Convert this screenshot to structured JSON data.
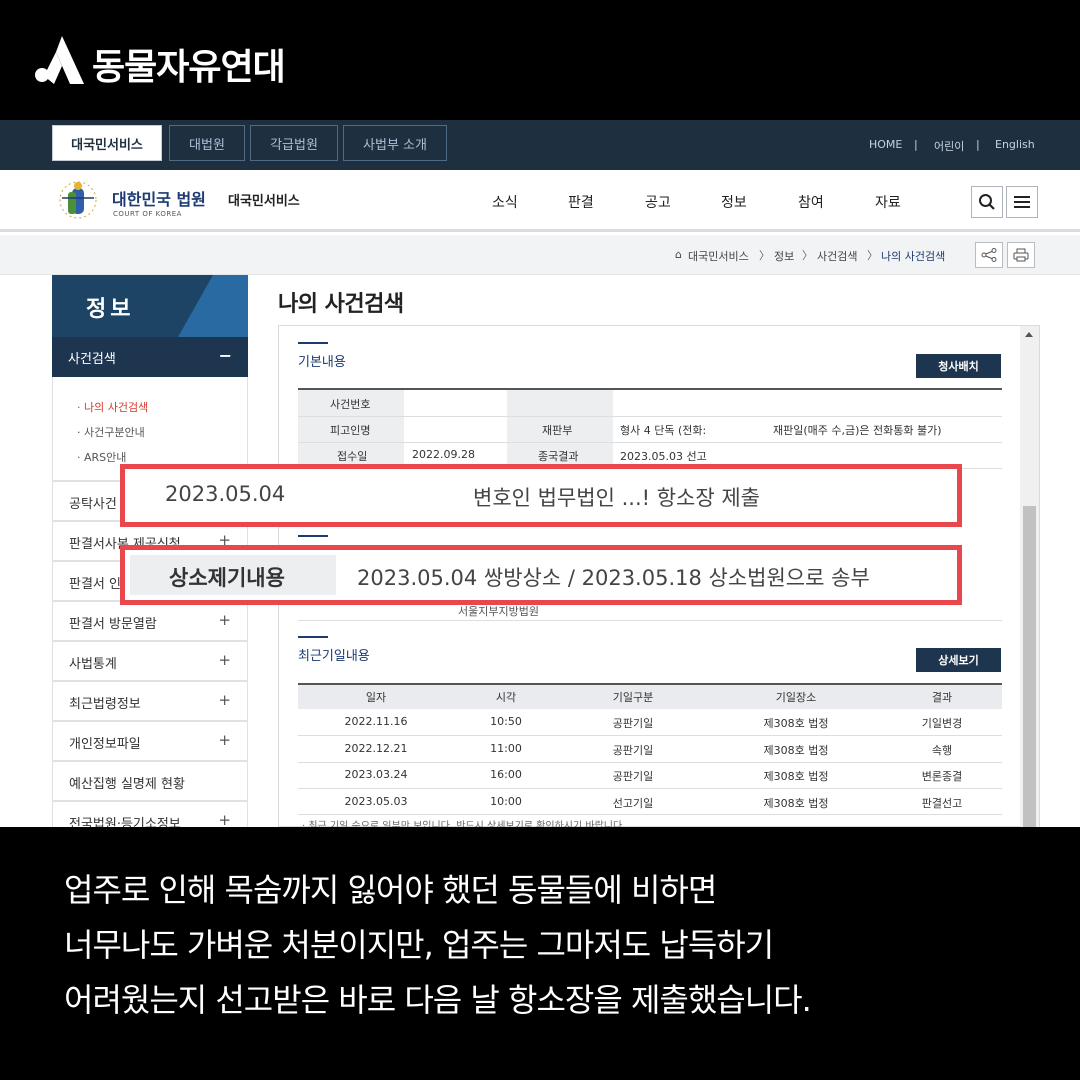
{
  "brand": {
    "name": "동물자유연대",
    "logo_icon": "triangle-person-logo"
  },
  "gnb": {
    "tabs": [
      "대국민서비스",
      "대법원",
      "각급법원",
      "사법부 소개"
    ],
    "utilities": [
      "HOME",
      "|",
      "어린이",
      "|",
      "English"
    ]
  },
  "header": {
    "court_name": "대한민국 법원",
    "court_name_en": "COURT OF KOREA",
    "service_name": "대국민서비스",
    "menu": [
      "소식",
      "판결",
      "공고",
      "정보",
      "참여",
      "자료"
    ]
  },
  "breadcrumb": {
    "home_icon": "home-icon",
    "items": [
      "대국민서비스",
      "정보",
      "사건검색",
      "나의 사건검색"
    ],
    "separator": "〉"
  },
  "sidebar": {
    "title": "정보",
    "active": {
      "label": "사건검색",
      "toggle": "−"
    },
    "subitems": [
      "· 나의 사건검색",
      "· 사건구분안내",
      "· ARS안내"
    ],
    "items": [
      {
        "label": "공탁사건",
        "toggle": "+"
      },
      {
        "label": "판결서사본 제공신청",
        "toggle": "+"
      },
      {
        "label": "판결서 인",
        "toggle": "+"
      },
      {
        "label": "판결서 방문열람",
        "toggle": "+"
      },
      {
        "label": "사법통계",
        "toggle": "+"
      },
      {
        "label": "최근법령정보",
        "toggle": "+"
      },
      {
        "label": "개인정보파일",
        "toggle": "+"
      },
      {
        "label": "예산집행 실명제 현황",
        "toggle": ""
      },
      {
        "label": "전국법원·등기소정보",
        "toggle": "+"
      }
    ]
  },
  "main": {
    "page_title": "나의 사건검색",
    "basic_section": {
      "title": "기본내용",
      "print_button": "청사배치",
      "labels": {
        "case_number": "사건번호",
        "defendant": "피고인명",
        "trial_division": "재판부",
        "received_date": "접수일",
        "final_result": "종국결과"
      },
      "values": {
        "trial_division": "형사 4 단독 (전화:",
        "trial_note": "재판일(매주 수,금)은 전화통화 불가)",
        "received_date": "2022.09.28",
        "final_result": "2023.05.03 선고"
      }
    },
    "partial_row_text": "서울지부지방법원",
    "recent_section": {
      "title": "최근기일내용",
      "detail_button": "상세보기",
      "columns": [
        "일자",
        "시각",
        "기일구분",
        "기일장소",
        "결과"
      ],
      "rows": [
        [
          "2022.11.16",
          "10:50",
          "공판기일",
          "제308호 법정",
          "기일변경"
        ],
        [
          "2022.12.21",
          "11:00",
          "공판기일",
          "제308호 법정",
          "속행"
        ],
        [
          "2023.03.24",
          "16:00",
          "공판기일",
          "제308호 법정",
          "변론종결"
        ],
        [
          "2023.05.03",
          "10:00",
          "선고기일",
          "제308호 법정",
          "판결선고"
        ]
      ],
      "note": "· 최근 기일 순으로 일부만 보입니다. 반드시 상세보기로 확인하시기 바랍니다."
    }
  },
  "highlights": {
    "first": {
      "date": "2023.05.04",
      "text": "변호인 법무법인 ...! 항소장 제출"
    },
    "second": {
      "label": "상소제기내용",
      "text": "2023.05.04 쌍방상소 / 2023.05.18 상소법원으로 송부"
    }
  },
  "caption": {
    "lines": [
      "업주로 인해 목숨까지 잃어야 했던 동물들에 비하면",
      "너무나도 가벼운 처분이지만, 업주는 그마저도 납득하기",
      "어려웠는지 선고받은 바로 다음 날 항소장을 제출했습니다."
    ]
  },
  "colors": {
    "gnb_bg": "#1e2f40",
    "sidebar_title_bg": "#1e4465",
    "highlight_border": "#e8474b",
    "link_active": "#d43b2a"
  }
}
